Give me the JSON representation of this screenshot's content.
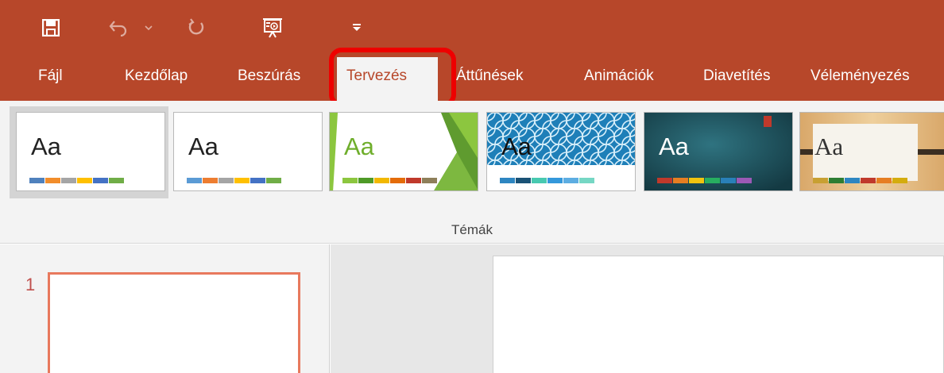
{
  "tabs": [
    {
      "label": "Fájl",
      "active": false
    },
    {
      "label": "Kezdőlap",
      "active": false
    },
    {
      "label": "Beszúrás",
      "active": false
    },
    {
      "label": "Tervezés",
      "active": true
    },
    {
      "label": "Áttűnések",
      "active": false
    },
    {
      "label": "Animációk",
      "active": false
    },
    {
      "label": "Diavetítés",
      "active": false
    },
    {
      "label": "Véleményezés",
      "active": false
    }
  ],
  "themes": [
    {
      "label": "Aa",
      "swatches": [
        "#4f81bd",
        "#f28d2b",
        "#a5a5a5",
        "#ffc000",
        "#4472c4",
        "#70ad47"
      ],
      "selected": true
    },
    {
      "label": "Aa",
      "swatches": [
        "#5b9bd5",
        "#ed7d31",
        "#a5a5a5",
        "#ffc000",
        "#4472c4",
        "#70ad47"
      ],
      "selected": false
    },
    {
      "label": "Aa",
      "swatches": [
        "#8cc63f",
        "#4e9a27",
        "#f2b800",
        "#e46c0a",
        "#c0392b",
        "#8e7f5a"
      ],
      "selected": false
    },
    {
      "label": "Aa",
      "swatches": [
        "#2e86c1",
        "#1a5276",
        "#48c9b0",
        "#3498db",
        "#5dade2",
        "#76d7c4"
      ],
      "selected": false
    },
    {
      "label": "Aa",
      "swatches": [
        "#c0392b",
        "#e67e22",
        "#f1c40f",
        "#27ae60",
        "#2980b9",
        "#9b59b6"
      ],
      "selected": false
    },
    {
      "label": "Aa",
      "swatches": [
        "#c8a032",
        "#2e7d32",
        "#2e86c1",
        "#c0392b",
        "#e67e22",
        "#d4ac0d"
      ],
      "selected": false
    }
  ],
  "ribbon": {
    "group_label": "Témák"
  },
  "slides": {
    "current_number": "1"
  },
  "colors": {
    "accent": "#b7472a",
    "highlight": "#ee0000",
    "thumb_border": "#e8795d"
  }
}
